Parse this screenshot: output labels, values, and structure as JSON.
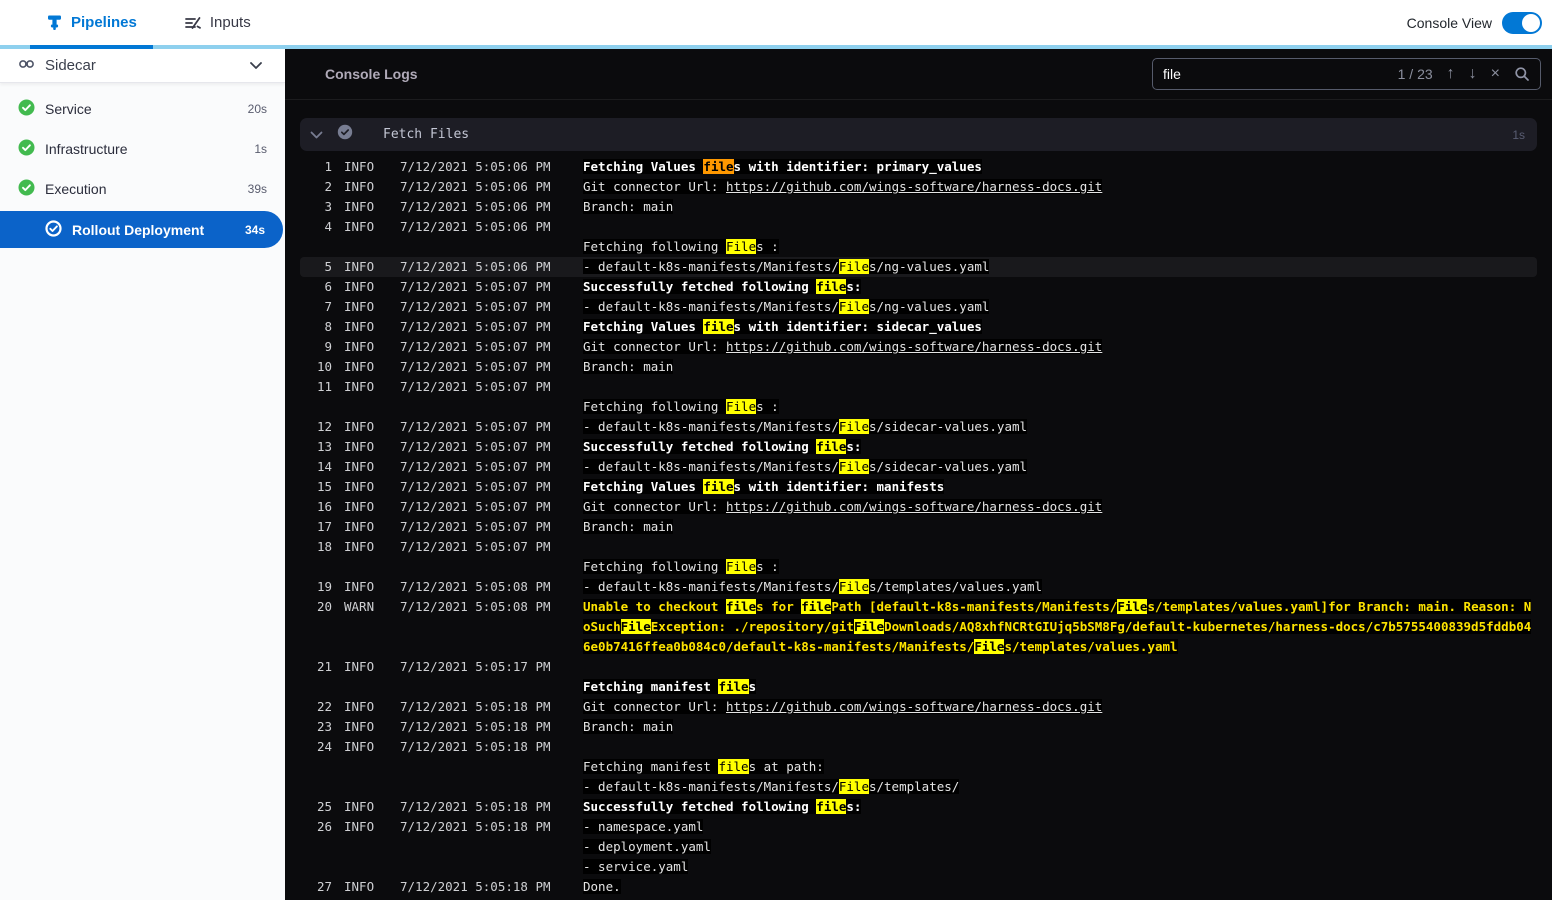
{
  "nav": {
    "tabs": [
      {
        "label": "Pipelines"
      },
      {
        "label": "Inputs"
      }
    ],
    "console_view_label": "Console View",
    "console_view_on": true
  },
  "sidebar": {
    "title": "Sidecar",
    "steps": [
      {
        "label": "Service",
        "duration": "20s",
        "status": "success"
      },
      {
        "label": "Infrastructure",
        "duration": "1s",
        "status": "success"
      },
      {
        "label": "Execution",
        "duration": "39s",
        "status": "success"
      },
      {
        "label": "Rollout Deployment",
        "duration": "34s",
        "status": "selected",
        "indent": true
      }
    ]
  },
  "console": {
    "title": "Console Logs",
    "search": {
      "query": "file",
      "count": "1 / 23"
    },
    "section": {
      "title": "Fetch Files",
      "duration": "1s"
    }
  },
  "logs": [
    {
      "n": 1,
      "level": "INFO",
      "time": "7/12/2021 5:05:06 PM",
      "lines": [
        {
          "text": "Fetching Values files with identifier: primary_values",
          "bold": true
        }
      ]
    },
    {
      "n": 2,
      "level": "INFO",
      "time": "7/12/2021 5:05:06 PM",
      "lines": [
        {
          "prefix": "Git connector Url: ",
          "link": "https://github.com/wings-software/harness-docs.git"
        }
      ]
    },
    {
      "n": 3,
      "level": "INFO",
      "time": "7/12/2021 5:05:06 PM",
      "lines": [
        {
          "text": "Branch: main"
        }
      ]
    },
    {
      "n": 4,
      "level": "INFO",
      "time": "7/12/2021 5:05:06 PM",
      "lines": [
        {
          "text": ""
        },
        {
          "text": "Fetching following Files :"
        }
      ]
    },
    {
      "n": 5,
      "level": "INFO",
      "time": "7/12/2021 5:05:06 PM",
      "selected": true,
      "lines": [
        {
          "text": "- default-k8s-manifests/Manifests/Files/ng-values.yaml"
        }
      ]
    },
    {
      "n": 6,
      "level": "INFO",
      "time": "7/12/2021 5:05:07 PM",
      "lines": [
        {
          "text": "Successfully fetched following files:",
          "bold": true
        }
      ]
    },
    {
      "n": 7,
      "level": "INFO",
      "time": "7/12/2021 5:05:07 PM",
      "lines": [
        {
          "text": "- default-k8s-manifests/Manifests/Files/ng-values.yaml"
        }
      ]
    },
    {
      "n": 8,
      "level": "INFO",
      "time": "7/12/2021 5:05:07 PM",
      "lines": [
        {
          "text": "Fetching Values files with identifier: sidecar_values",
          "bold": true
        }
      ]
    },
    {
      "n": 9,
      "level": "INFO",
      "time": "7/12/2021 5:05:07 PM",
      "lines": [
        {
          "prefix": "Git connector Url: ",
          "link": "https://github.com/wings-software/harness-docs.git"
        }
      ]
    },
    {
      "n": 10,
      "level": "INFO",
      "time": "7/12/2021 5:05:07 PM",
      "lines": [
        {
          "text": "Branch: main"
        }
      ]
    },
    {
      "n": 11,
      "level": "INFO",
      "time": "7/12/2021 5:05:07 PM",
      "lines": [
        {
          "text": ""
        },
        {
          "text": "Fetching following Files :"
        }
      ]
    },
    {
      "n": 12,
      "level": "INFO",
      "time": "7/12/2021 5:05:07 PM",
      "lines": [
        {
          "text": "- default-k8s-manifests/Manifests/Files/sidecar-values.yaml"
        }
      ]
    },
    {
      "n": 13,
      "level": "INFO",
      "time": "7/12/2021 5:05:07 PM",
      "lines": [
        {
          "text": "Successfully fetched following files:",
          "bold": true
        }
      ]
    },
    {
      "n": 14,
      "level": "INFO",
      "time": "7/12/2021 5:05:07 PM",
      "lines": [
        {
          "text": "- default-k8s-manifests/Manifests/Files/sidecar-values.yaml"
        }
      ]
    },
    {
      "n": 15,
      "level": "INFO",
      "time": "7/12/2021 5:05:07 PM",
      "lines": [
        {
          "text": "Fetching Values files with identifier: manifests",
          "bold": true
        }
      ]
    },
    {
      "n": 16,
      "level": "INFO",
      "time": "7/12/2021 5:05:07 PM",
      "lines": [
        {
          "prefix": "Git connector Url: ",
          "link": "https://github.com/wings-software/harness-docs.git"
        }
      ]
    },
    {
      "n": 17,
      "level": "INFO",
      "time": "7/12/2021 5:05:07 PM",
      "lines": [
        {
          "text": "Branch: main"
        }
      ]
    },
    {
      "n": 18,
      "level": "INFO",
      "time": "7/12/2021 5:05:07 PM",
      "lines": [
        {
          "text": ""
        },
        {
          "text": "Fetching following Files :"
        }
      ]
    },
    {
      "n": 19,
      "level": "INFO",
      "time": "7/12/2021 5:05:08 PM",
      "lines": [
        {
          "text": "- default-k8s-manifests/Manifests/Files/templates/values.yaml"
        }
      ]
    },
    {
      "n": 20,
      "level": "WARN",
      "time": "7/12/2021 5:05:08 PM",
      "lines": [
        {
          "text": "Unable to checkout files for filePath [default-k8s-manifests/Manifests/Files/templates/values.yaml]for Branch: main. Reason: NoSuchFileException: ./repository/gitFileDownloads/AQ8xhfNCRtGIUjq5bSM8Fg/default-kubernetes/harness-docs/c7b5755400839d5fddb046e0b7416ffea0b084c0/default-k8s-manifests/Manifests/Files/templates/values.yaml",
          "warn": true
        }
      ]
    },
    {
      "n": 21,
      "level": "INFO",
      "time": "7/12/2021 5:05:17 PM",
      "lines": [
        {
          "text": ""
        },
        {
          "text": "Fetching manifest files",
          "bold": true
        }
      ]
    },
    {
      "n": 22,
      "level": "INFO",
      "time": "7/12/2021 5:05:18 PM",
      "lines": [
        {
          "prefix": "Git connector Url: ",
          "link": "https://github.com/wings-software/harness-docs.git"
        }
      ]
    },
    {
      "n": 23,
      "level": "INFO",
      "time": "7/12/2021 5:05:18 PM",
      "lines": [
        {
          "text": "Branch: main"
        }
      ]
    },
    {
      "n": 24,
      "level": "INFO",
      "time": "7/12/2021 5:05:18 PM",
      "lines": [
        {
          "text": ""
        },
        {
          "text": "Fetching manifest files at path:"
        },
        {
          "text": "- default-k8s-manifests/Manifests/Files/templates/"
        }
      ]
    },
    {
      "n": 25,
      "level": "INFO",
      "time": "7/12/2021 5:05:18 PM",
      "lines": [
        {
          "text": "Successfully fetched following files:",
          "bold": true
        }
      ]
    },
    {
      "n": 26,
      "level": "INFO",
      "time": "7/12/2021 5:05:18 PM",
      "lines": [
        {
          "text": "- namespace.yaml"
        },
        {
          "text": "- deployment.yaml"
        },
        {
          "text": "- service.yaml"
        }
      ]
    },
    {
      "n": 27,
      "level": "INFO",
      "time": "7/12/2021 5:05:18 PM",
      "lines": [
        {
          "text": "Done."
        }
      ]
    }
  ],
  "colors": {
    "brand_blue": "#0278d5",
    "light_blue_border": "#8ed0ee",
    "selected_step_blue": "#0b63c9",
    "success_green": "#42ba4f",
    "console_bg": "#0b0b0d",
    "match_highlight": "#ffff00",
    "active_match_highlight": "#ff9800",
    "warn_yellow": "#fde300"
  }
}
